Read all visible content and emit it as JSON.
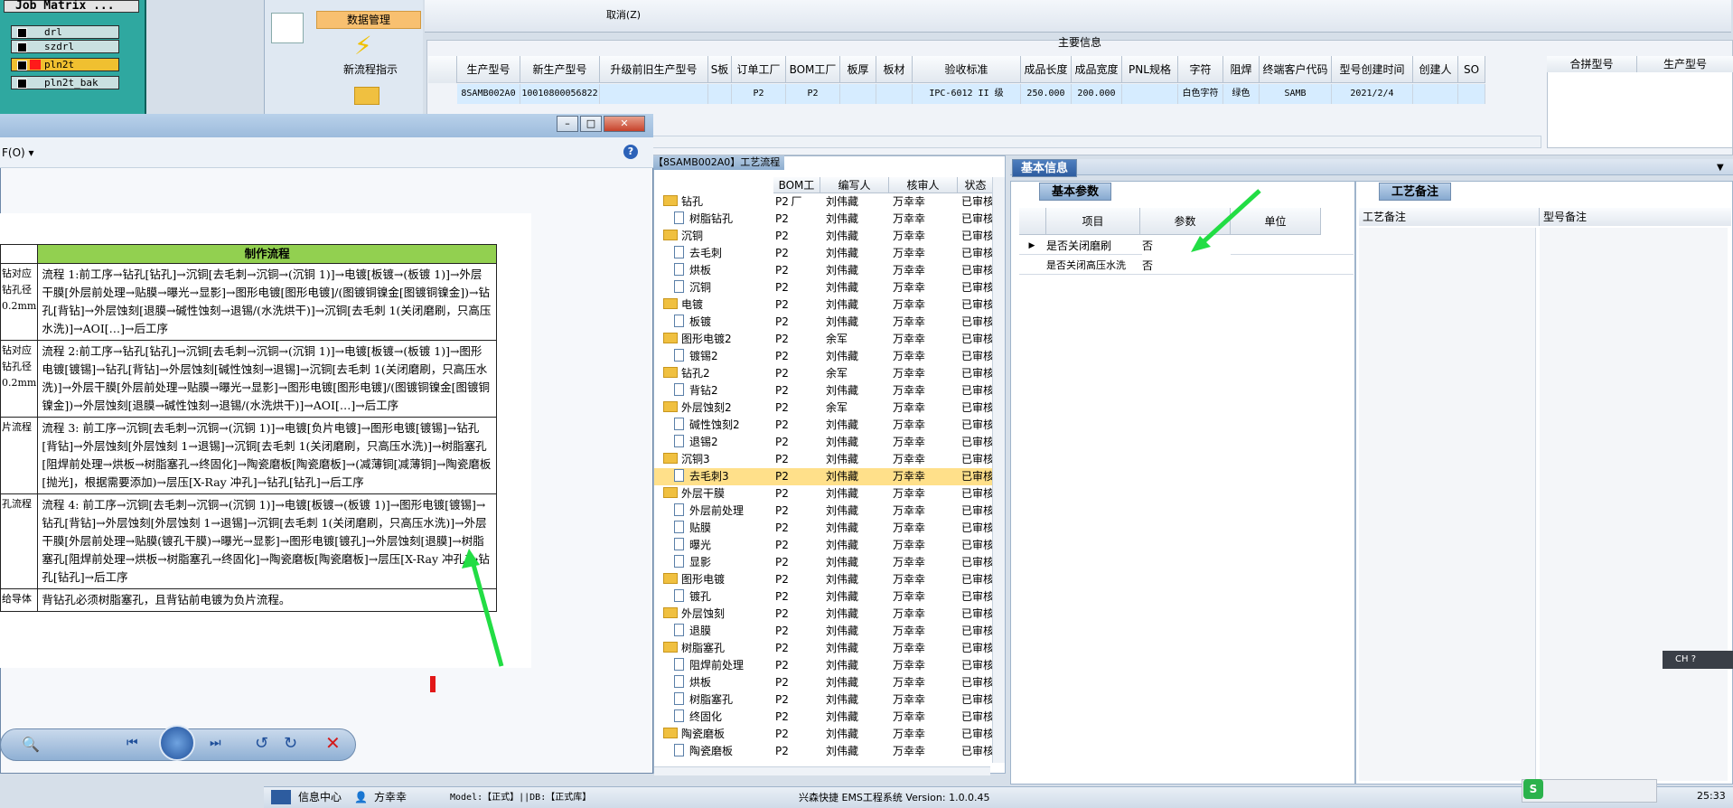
{
  "job_matrix": {
    "title": "Job Matrix ...",
    "items": [
      {
        "label": "drl",
        "flag": false
      },
      {
        "label": "szdrl",
        "flag": false
      },
      {
        "label": "pln2t",
        "flag": true,
        "selected": true
      },
      {
        "label": "pln2t_bak",
        "flag": false
      }
    ]
  },
  "nav": {
    "data_mgmt": "数据管理",
    "new_flow": "新流程指示"
  },
  "menu": {
    "cancel": "取消(Z)"
  },
  "main_info": {
    "title": "主要信息",
    "columns": [
      "生产型号",
      "新生产型号",
      "升级前旧生产型号",
      "S板",
      "订单工厂",
      "BOM工厂",
      "板厚",
      "板材",
      "验收标准",
      "成品长度",
      "成品宽度",
      "PNL规格",
      "字符",
      "阻焊",
      "终端客户代码",
      "型号创建时间",
      "创建人",
      "SO"
    ],
    "row": [
      "8SAMB002A0",
      "10010800056822",
      "",
      "",
      "P2",
      "P2",
      "",
      "",
      "IPC-6012 II 级",
      "250.000",
      "200.000",
      "",
      "白色字符",
      "绿色",
      "SAMB",
      "2021/2/4",
      "",
      ""
    ],
    "side_columns": [
      "合拼型号",
      "生产型号"
    ]
  },
  "viewer": {
    "menu_label": "F(O)",
    "table_header": "制作流程",
    "rows": [
      {
        "label": "钻对应钻孔径0.2mm",
        "text": "流程 1:前工序→钻孔[钻孔]→沉铜[去毛刺→沉铜→(沉铜 1)]→电镀[板镀→(板镀 1)]→外层干膜[外层前处理→贴膜→曝光→显影]→图形电镀[图形电镀]/(图镀铜镍金[图镀铜镍金])→钻孔[背钻]→外层蚀刻[退膜→碱性蚀刻→退锡/(水洗烘干)]→沉铜[去毛刺 1(关闭磨刷，只高压水洗)]→AOI[…]→后工序"
      },
      {
        "label": "钻对应钻孔径0.2mm",
        "text": "流程 2:前工序→钻孔[钻孔]→沉铜[去毛刺→沉铜→(沉铜 1)]→电镀[板镀→(板镀 1)]→图形电镀[镀锡]→钻孔[背钻]→外层蚀刻[碱性蚀刻→退锡]→沉铜[去毛刺 1(关闭磨刷，只高压水洗)]→外层干膜[外层前处理→贴膜→曝光→显影]→图形电镀[图形电镀]/(图镀铜镍金[图镀铜镍金])→外层蚀刻[退膜→碱性蚀刻→退锡/(水洗烘干)]→AOI[…]→后工序"
      },
      {
        "label": "片流程",
        "text": "流程 3: 前工序→沉铜[去毛刺→沉铜→(沉铜 1)]→电镀[负片电镀]→图形电镀[镀锡]→钻孔[背钻]→外层蚀刻[外层蚀刻 1→退锡]→沉铜[去毛刺 1(关闭磨刷，只高压水洗)]→树脂塞孔[阻焊前处理→烘板→树脂塞孔→终固化]→陶瓷磨板[陶瓷磨板]→(减薄铜[减薄铜]→陶瓷磨板[抛光]，根据需要添加)→层压[X-Ray 冲孔]→钻孔[钻孔]→后工序"
      },
      {
        "label": "孔流程",
        "text": "流程 4: 前工序→沉铜[去毛刺→沉铜→(沉铜 1)]→电镀[板镀→(板镀 1)]→图形电镀[镀锡]→钻孔[背钻]→外层蚀刻[外层蚀刻 1→退锡]→沉铜[去毛刺 1(关闭磨刷，只高压水洗)]→外层干膜[外层前处理→贴膜(镀孔干膜)→曝光→显影]→图形电镀[镀孔]→外层蚀刻[退膜]→树脂塞孔[阻焊前处理→烘板→树脂塞孔→终固化]→陶瓷磨板[陶瓷磨板]→层压[X-Ray 冲孔]→钻孔[钻孔]→后工序"
      },
      {
        "label": "给导体",
        "text": "背钻孔必须树脂塞孔，且背钻前电镀为负片流程。"
      }
    ]
  },
  "tree": {
    "title": "【8SAMB002A0】工艺流程",
    "columns": [
      "BOM工厂",
      "编写人",
      "核审人",
      "状态"
    ],
    "rows": [
      {
        "name": "钻孔",
        "folder": true,
        "f": "P2",
        "w": "刘伟藏",
        "r": "万幸幸",
        "s": "已审核"
      },
      {
        "name": "树脂钻孔",
        "folder": false,
        "f": "P2",
        "w": "刘伟藏",
        "r": "万幸幸",
        "s": "已审核"
      },
      {
        "name": "沉铜",
        "folder": true,
        "f": "P2",
        "w": "刘伟藏",
        "r": "万幸幸",
        "s": "已审核"
      },
      {
        "name": "去毛刺",
        "folder": false,
        "f": "P2",
        "w": "刘伟藏",
        "r": "万幸幸",
        "s": "已审核"
      },
      {
        "name": "烘板",
        "folder": false,
        "f": "P2",
        "w": "刘伟藏",
        "r": "万幸幸",
        "s": "已审核"
      },
      {
        "name": "沉铜",
        "folder": false,
        "f": "P2",
        "w": "刘伟藏",
        "r": "万幸幸",
        "s": "已审核"
      },
      {
        "name": "电镀",
        "folder": true,
        "f": "P2",
        "w": "刘伟藏",
        "r": "万幸幸",
        "s": "已审核"
      },
      {
        "name": "板镀",
        "folder": false,
        "f": "P2",
        "w": "刘伟藏",
        "r": "万幸幸",
        "s": "已审核"
      },
      {
        "name": "图形电镀2",
        "folder": true,
        "f": "P2",
        "w": "余军",
        "r": "万幸幸",
        "s": "已审核"
      },
      {
        "name": "镀锡2",
        "folder": false,
        "f": "P2",
        "w": "刘伟藏",
        "r": "万幸幸",
        "s": "已审核"
      },
      {
        "name": "钻孔2",
        "folder": true,
        "f": "P2",
        "w": "余军",
        "r": "万幸幸",
        "s": "已审核"
      },
      {
        "name": "背钻2",
        "folder": false,
        "f": "P2",
        "w": "刘伟藏",
        "r": "万幸幸",
        "s": "已审核"
      },
      {
        "name": "外层蚀刻2",
        "folder": true,
        "f": "P2",
        "w": "余军",
        "r": "万幸幸",
        "s": "已审核"
      },
      {
        "name": "碱性蚀刻2",
        "folder": false,
        "f": "P2",
        "w": "刘伟藏",
        "r": "万幸幸",
        "s": "已审核"
      },
      {
        "name": "退锡2",
        "folder": false,
        "f": "P2",
        "w": "刘伟藏",
        "r": "万幸幸",
        "s": "已审核"
      },
      {
        "name": "沉铜3",
        "folder": true,
        "f": "P2",
        "w": "刘伟藏",
        "r": "万幸幸",
        "s": "已审核"
      },
      {
        "name": "去毛刺3",
        "folder": false,
        "f": "P2",
        "w": "刘伟藏",
        "r": "万幸幸",
        "s": "已审核",
        "hl": true
      },
      {
        "name": "外层干膜",
        "folder": true,
        "f": "P2",
        "w": "刘伟藏",
        "r": "万幸幸",
        "s": "已审核"
      },
      {
        "name": "外层前处理",
        "folder": false,
        "f": "P2",
        "w": "刘伟藏",
        "r": "万幸幸",
        "s": "已审核"
      },
      {
        "name": "贴膜",
        "folder": false,
        "f": "P2",
        "w": "刘伟藏",
        "r": "万幸幸",
        "s": "已审核"
      },
      {
        "name": "曝光",
        "folder": false,
        "f": "P2",
        "w": "刘伟藏",
        "r": "万幸幸",
        "s": "已审核"
      },
      {
        "name": "显影",
        "folder": false,
        "f": "P2",
        "w": "刘伟藏",
        "r": "万幸幸",
        "s": "已审核"
      },
      {
        "name": "图形电镀",
        "folder": true,
        "f": "P2",
        "w": "刘伟藏",
        "r": "万幸幸",
        "s": "已审核"
      },
      {
        "name": "镀孔",
        "folder": false,
        "f": "P2",
        "w": "刘伟藏",
        "r": "万幸幸",
        "s": "已审核"
      },
      {
        "name": "外层蚀刻",
        "folder": true,
        "f": "P2",
        "w": "刘伟藏",
        "r": "万幸幸",
        "s": "已审核"
      },
      {
        "name": "退膜",
        "folder": false,
        "f": "P2",
        "w": "刘伟藏",
        "r": "万幸幸",
        "s": "已审核"
      },
      {
        "name": "树脂塞孔",
        "folder": true,
        "f": "P2",
        "w": "刘伟藏",
        "r": "万幸幸",
        "s": "已审核"
      },
      {
        "name": "阻焊前处理",
        "folder": false,
        "f": "P2",
        "w": "刘伟藏",
        "r": "万幸幸",
        "s": "已审核"
      },
      {
        "name": "烘板",
        "folder": false,
        "f": "P2",
        "w": "刘伟藏",
        "r": "万幸幸",
        "s": "已审核"
      },
      {
        "name": "树脂塞孔",
        "folder": false,
        "f": "P2",
        "w": "刘伟藏",
        "r": "万幸幸",
        "s": "已审核"
      },
      {
        "name": "终固化",
        "folder": false,
        "f": "P2",
        "w": "刘伟藏",
        "r": "万幸幸",
        "s": "已审核"
      },
      {
        "name": "陶瓷磨板",
        "folder": true,
        "f": "P2",
        "w": "刘伟藏",
        "r": "万幸幸",
        "s": "已审核"
      },
      {
        "name": "陶瓷磨板",
        "folder": false,
        "f": "P2",
        "w": "刘伟藏",
        "r": "万幸幸",
        "s": "已审核"
      }
    ]
  },
  "basic_info": {
    "title": "基本信息",
    "tab": "基本参数",
    "columns": [
      "项目",
      "参数",
      "单位"
    ],
    "rows": [
      {
        "item": "是否关闭磨刷",
        "value": "否",
        "unit": ""
      },
      {
        "item": "是否关闭高压水洗",
        "value": "否",
        "unit": ""
      }
    ]
  },
  "craft_note": {
    "tab": "工艺备注",
    "columns": [
      "工艺备注",
      "型号备注"
    ]
  },
  "status": {
    "info_center": "信息中心",
    "user": "方幸幸",
    "model": "Model:【正式】||DB:【正式库】",
    "system": "兴森快捷 EMS工程系统 Version: 1.0.0.45",
    "ime": "CH",
    "time": "25:33"
  },
  "colors": {
    "accent": "#92d050",
    "highlight": "#ffe08a",
    "arrow": "#22dd44"
  }
}
